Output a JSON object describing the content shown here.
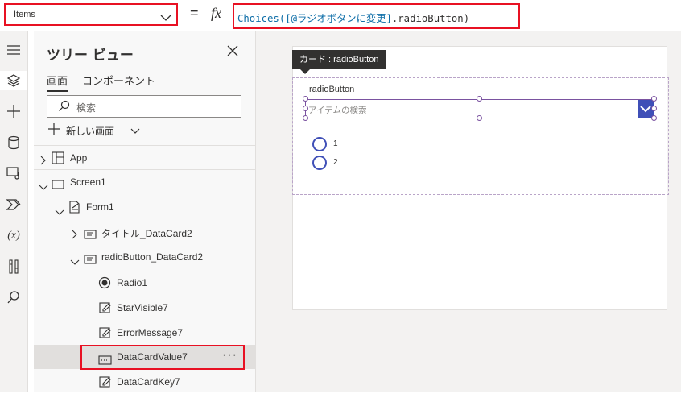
{
  "formula_bar": {
    "property": "Items",
    "equals": "=",
    "fx": "fx",
    "formula_fn": "Choices(",
    "formula_arg": "[@ラジオボタンに変更]",
    "formula_tail": ".radioButton)"
  },
  "rail": {
    "icons": [
      "hamburger-icon",
      "layers-icon",
      "plus-icon",
      "database-icon",
      "media-icon",
      "power-automate-icon",
      "variables-icon",
      "tools-icon",
      "search-icon"
    ]
  },
  "tree": {
    "title": "ツリー ビュー",
    "tabs": [
      "画面",
      "コンポーネント"
    ],
    "search_placeholder": "検索",
    "new_screen": "新しい画面",
    "rows": [
      {
        "label": "App"
      },
      {
        "label": "Screen1"
      },
      {
        "label": "Form1"
      },
      {
        "label": "タイトル_DataCard2"
      },
      {
        "label": "radioButton_DataCard2"
      },
      {
        "label": "Radio1"
      },
      {
        "label": "StarVisible7"
      },
      {
        "label": "ErrorMessage7"
      },
      {
        "label": "DataCardValue7"
      },
      {
        "label": "DataCardKey7"
      }
    ],
    "selected_more": "···"
  },
  "canvas": {
    "tooltip": "カード : radioButton",
    "card_label": "radioButton",
    "combo_placeholder": "アイテムの検索",
    "radio_options": [
      "1",
      "2"
    ]
  },
  "colors": {
    "highlight": "#e81123",
    "accent": "#3f4fb7",
    "selection": "#7a52a0"
  }
}
